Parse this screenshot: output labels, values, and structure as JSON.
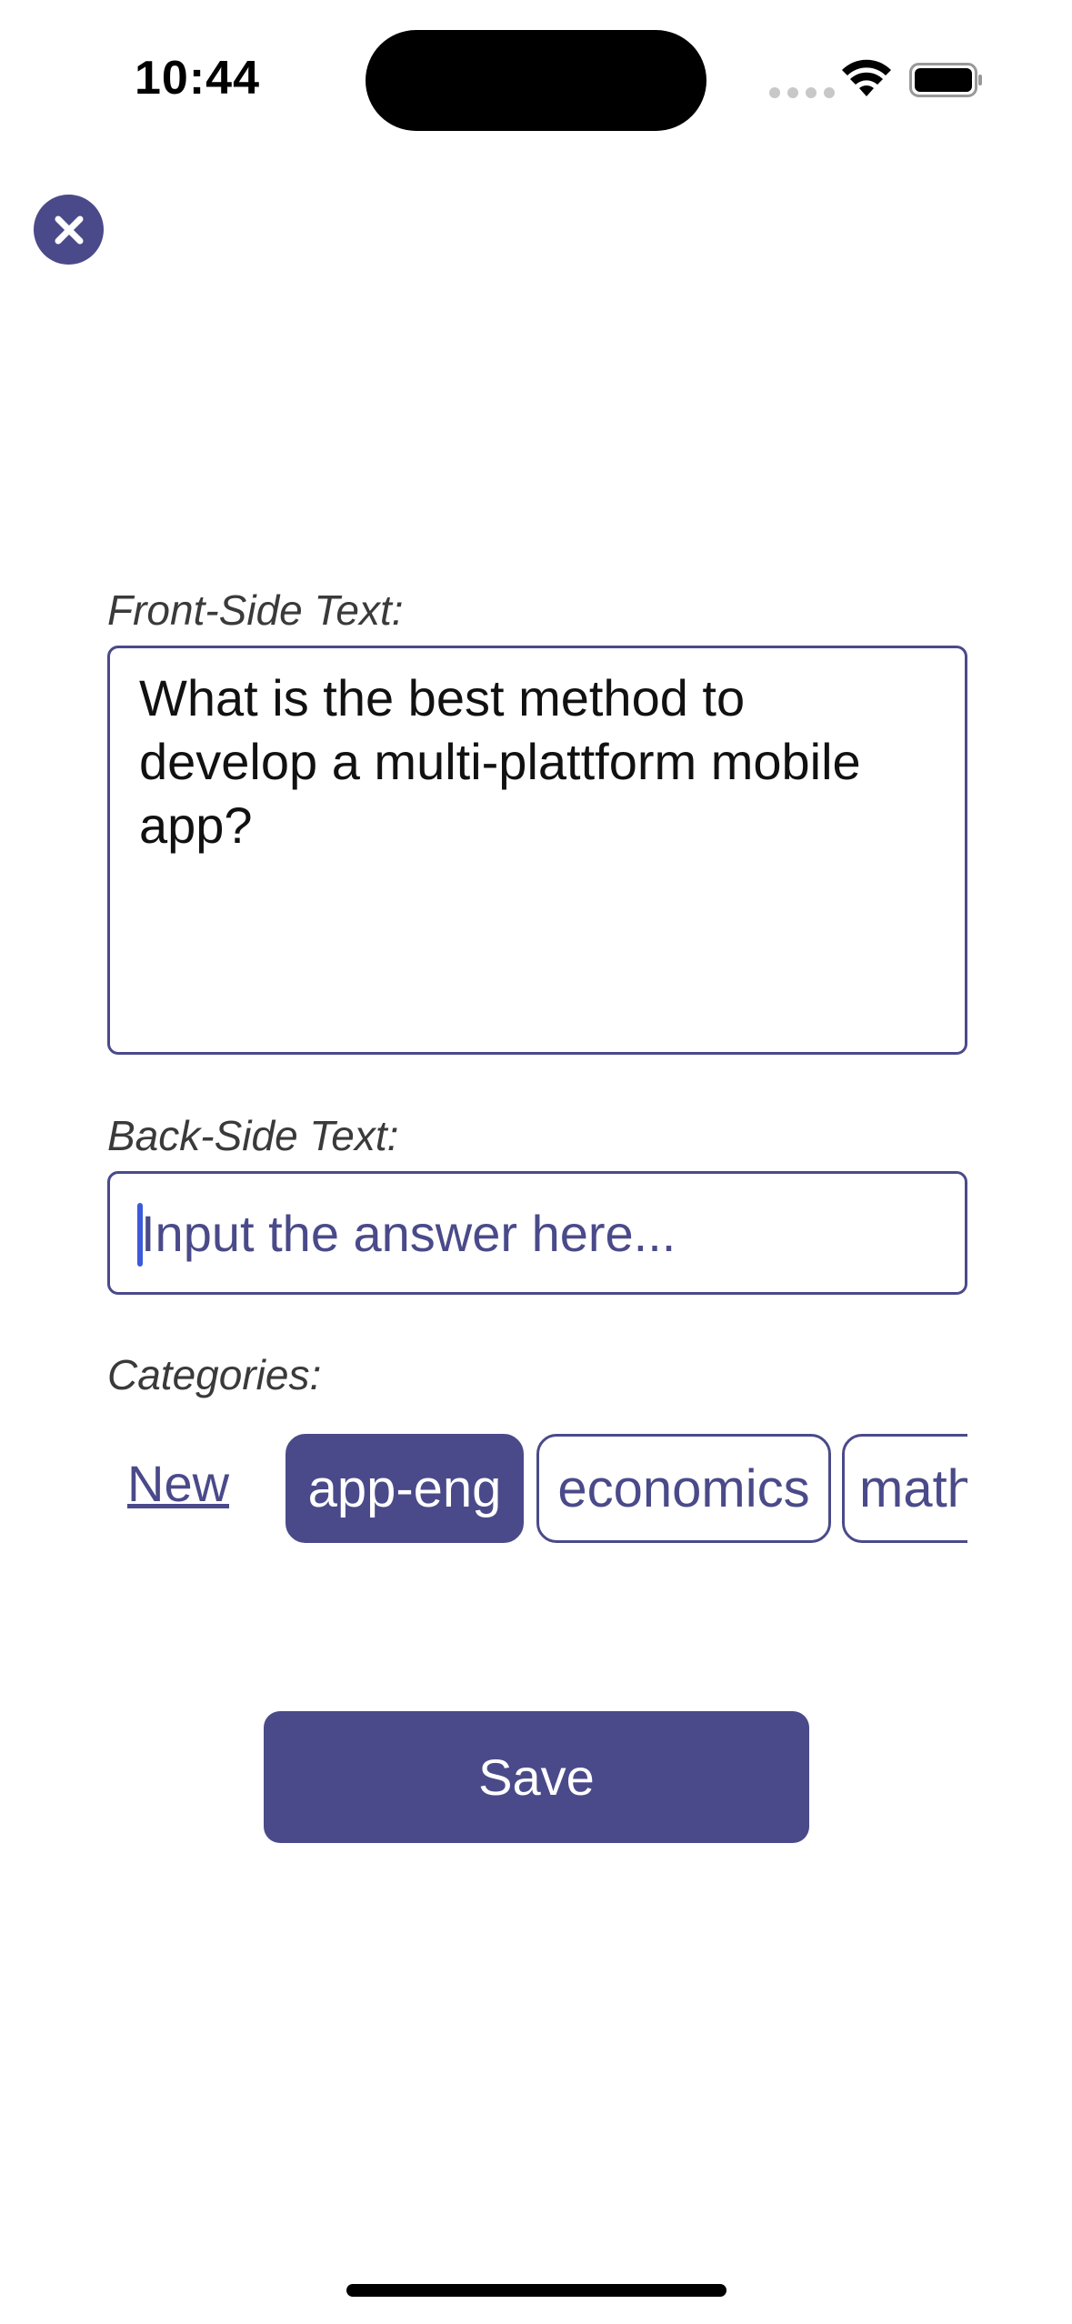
{
  "status_bar": {
    "time": "10:44"
  },
  "close": {
    "icon": "close-icon",
    "color": "#4a4a8a"
  },
  "form": {
    "front_label": "Front-Side Text:",
    "front_value": "What is the best method to develop a multi-plattform mobile app?",
    "back_label": "Back-Side Text:",
    "back_placeholder": "Input the answer here...",
    "back_value": "",
    "categories_label": "Categories:"
  },
  "categories": {
    "new_label": "New",
    "items": [
      {
        "label": "app-eng",
        "selected": true
      },
      {
        "label": "economics",
        "selected": false
      },
      {
        "label": "math",
        "selected": false
      }
    ]
  },
  "save": {
    "label": "Save"
  },
  "theme": {
    "accent": "#4a4a8a",
    "cursor": "#3b5bdb"
  }
}
